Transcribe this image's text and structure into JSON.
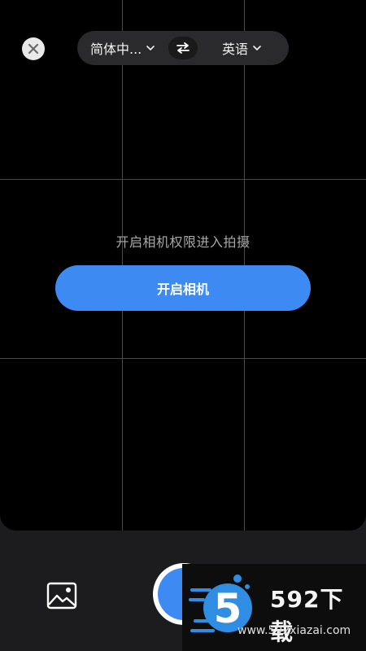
{
  "header": {
    "source_language": "简体中...",
    "target_language": "英语"
  },
  "main": {
    "permission_hint": "开启相机权限进入拍摄",
    "open_camera_label": "开启相机"
  },
  "watermark": {
    "logo_digit": "5",
    "brand": "592下载",
    "url": "www.592xiazai.com"
  },
  "colors": {
    "accent": "#3d8bf2",
    "viewfinder_bg": "#000000",
    "bottom_bar_bg": "#1c1c1e"
  },
  "icons": [
    "close-icon",
    "chevron-down-icon",
    "swap-icon",
    "gallery-icon",
    "shutter-icon"
  ]
}
